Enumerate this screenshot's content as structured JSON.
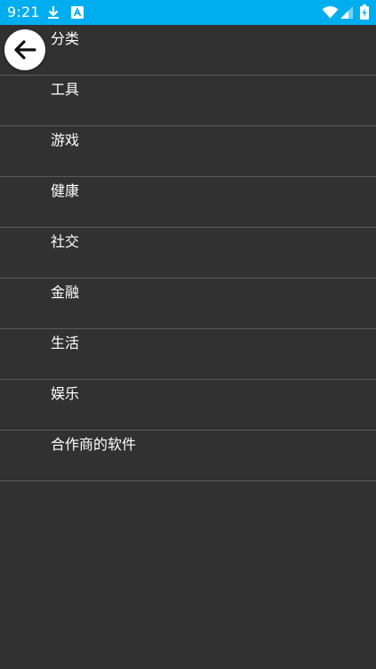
{
  "status_bar": {
    "time": "9:21",
    "background_color": "#00AEEF",
    "icons": [
      "download-icon",
      "a-notification-icon",
      "wifi-icon",
      "signal-icon",
      "battery-charging-icon"
    ]
  },
  "back_button": {
    "icon": "arrow-left-icon"
  },
  "categories": [
    {
      "label": "分类"
    },
    {
      "label": "工具"
    },
    {
      "label": "游戏"
    },
    {
      "label": "健康"
    },
    {
      "label": "社交"
    },
    {
      "label": "金融"
    },
    {
      "label": "生活"
    },
    {
      "label": "娱乐"
    },
    {
      "label": "合作商的软件"
    }
  ],
  "colors": {
    "background": "#313131",
    "divider": "#5a5a5a",
    "text": "#ffffff"
  }
}
